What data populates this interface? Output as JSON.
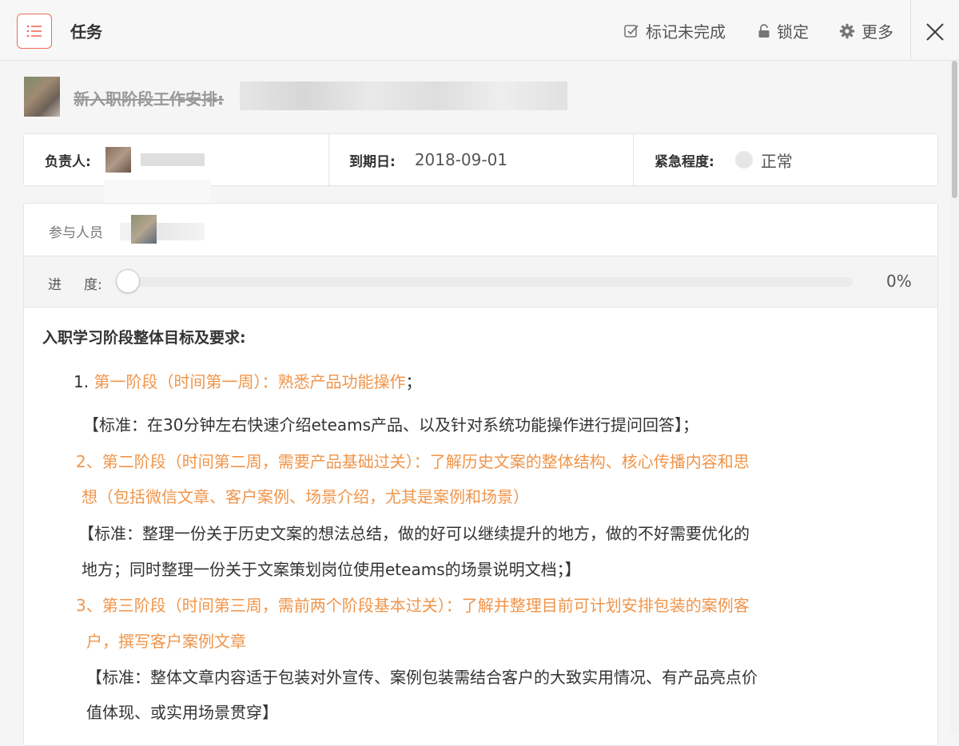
{
  "header": {
    "title": "任务",
    "mark_incomplete": "标记未完成",
    "lock": "锁定",
    "more": "更多"
  },
  "task": {
    "title": "新入职阶段工作安排:"
  },
  "info": {
    "assignee_label": "负责人:",
    "due_label": "到期日:",
    "due_value": "2018-09-01",
    "urgency_label": "紧急程度:",
    "urgency_value": "正常"
  },
  "participants": {
    "label": "参与人员"
  },
  "progress": {
    "label_a": "进",
    "label_b": "度:",
    "value": 0,
    "percent_text": "0%"
  },
  "content": {
    "heading": "入职学习阶段整体目标及要求:",
    "lines": [
      {
        "text": "1. 第一阶段（时间第一周）：熟悉产品功能操作；",
        "color": "mixed1"
      },
      {
        "text": "【标准：在30分钟左右快速介绍eteams产品、以及针对系统功能操作进行提问回答】；",
        "color": "black"
      },
      {
        "text": "2、第二阶段（时间第二周，需要产品基础过关）：了解历史文案的整体结构、核心传播内容和思",
        "color": "orange"
      },
      {
        "text": "想（包括微信文章、客户案例、场景介绍，尤其是案例和场景）",
        "color": "orange"
      },
      {
        "text": "【标准：整理一份关于历史文案的想法总结，做的好可以继续提升的地方，做的不好需要优化的",
        "color": "black"
      },
      {
        "text": "地方；同时整理一份关于文案策划岗位使用eteams的场景说明文档；】",
        "color": "black"
      },
      {
        "text": "3、第三阶段（时间第三周，需前两个阶段基本过关）：了解并整理目前可计划安排包装的案例客",
        "color": "orange"
      },
      {
        "text": "户，撰写客户案例文章",
        "color": "orange"
      },
      {
        "text": "【标准：整体文章内容适于包装对外宣传、案例包装需结合客户的大致实用情况、有产品亮点价",
        "color": "black"
      },
      {
        "text": "值体现、或实用场景贯穿】",
        "color": "black"
      }
    ],
    "line1_prefix": "1.",
    "line1_body": "第一阶段（时间第一周）：熟悉产品功能操作",
    "line1_suffix": "；"
  },
  "colors": {
    "accent_red": "#ef6b5d",
    "orange_text": "#f0954a"
  },
  "icons": [
    "list-icon",
    "checkbox-icon",
    "lock-icon",
    "gear-icon",
    "close-icon"
  ]
}
